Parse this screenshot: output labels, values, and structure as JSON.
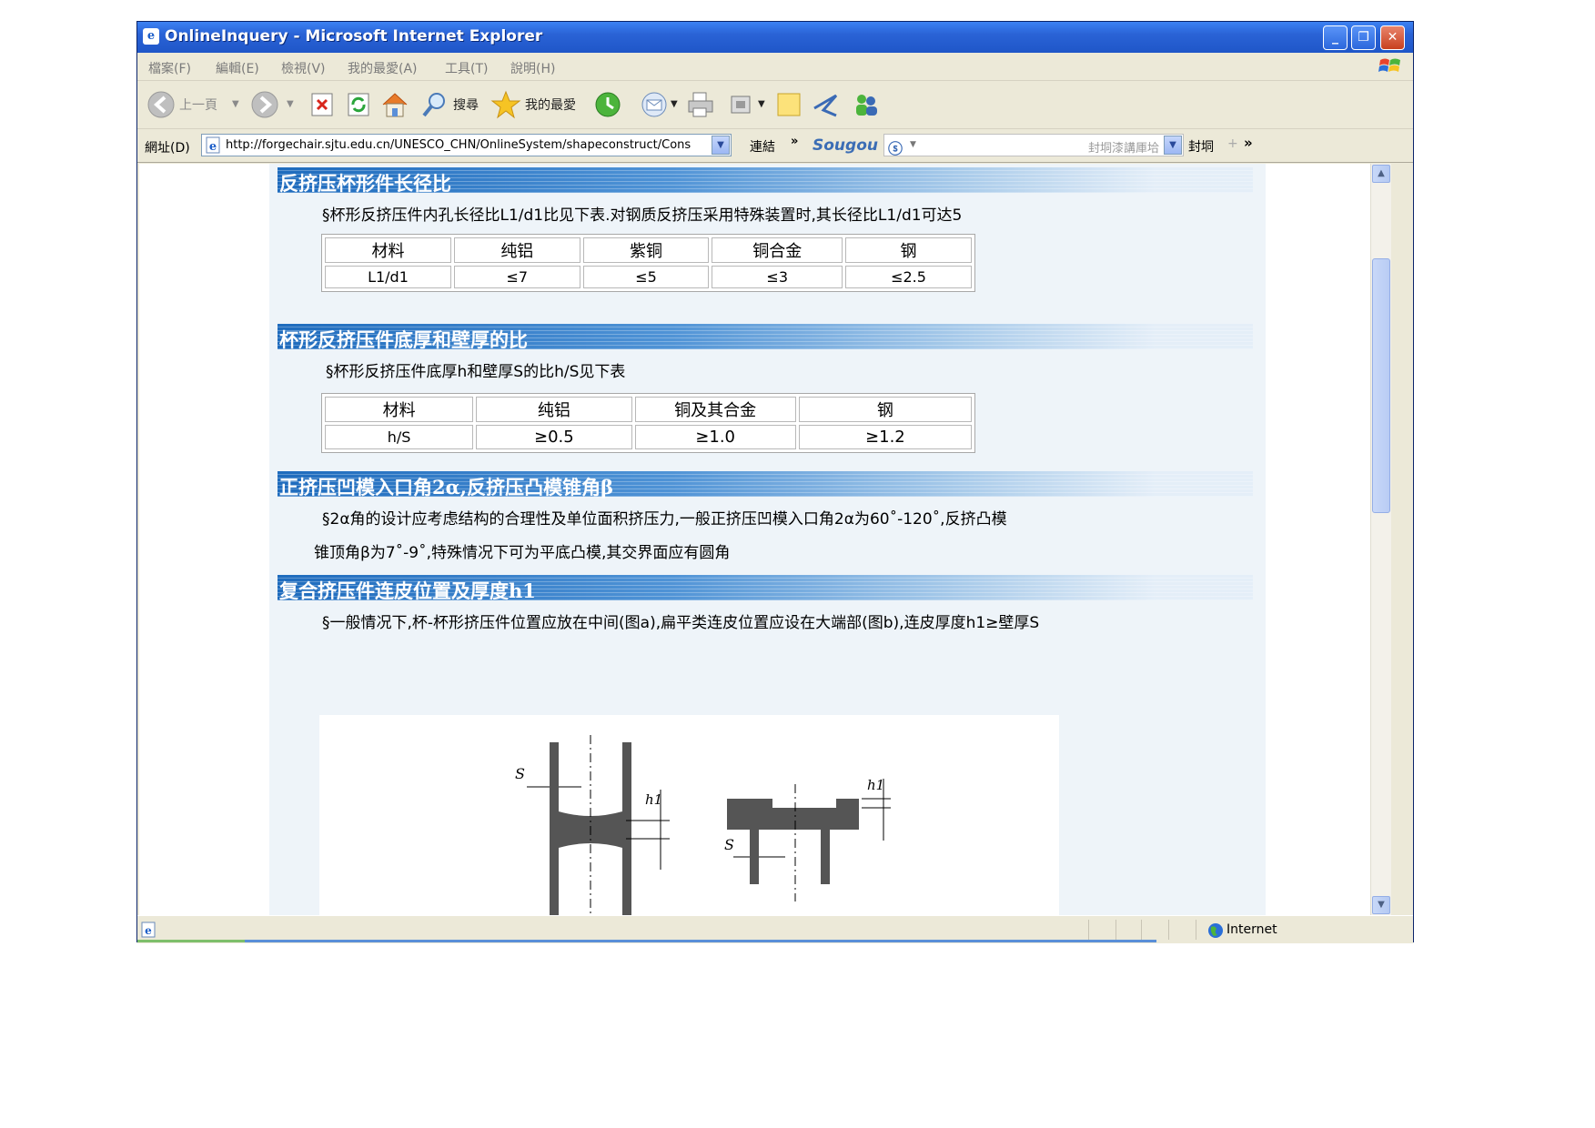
{
  "window": {
    "title": "OnlineInquery - Microsoft Internet Explorer",
    "icon": "ie-icon"
  },
  "menu": [
    "檔案(F)",
    "編輯(E)",
    "檢視(V)",
    "我的最愛(A)",
    "工具(T)",
    "說明(H)"
  ],
  "toolbar": {
    "back_label": "上一頁",
    "search_label": "搜尋",
    "favorites_label": "我的最愛"
  },
  "address": {
    "label": "網址(D)",
    "url": "http://forgechair.sjtu.edu.cn/UNESCO_CHN/OnlineSystem/shapeconstruct/Cons",
    "links_label": "連結",
    "sougou_label": "Sougou",
    "search_placeholder": "封垌漆講厙垥",
    "search_button": "封垌"
  },
  "sections": [
    {
      "title": "反挤压杯形件长径比",
      "text": "§杯形反挤压件内孔长径比L1/d1比见下表.对钢质反挤压采用特殊装置时,其长径比L1/d1可达5",
      "table": [
        [
          "材料",
          "纯铝",
          "紫铜",
          "铜合金",
          "钢"
        ],
        [
          "L1/d1",
          "≤7",
          "≤5",
          "≤3",
          "≤2.5"
        ]
      ]
    },
    {
      "title": "杯形反挤压件底厚和壁厚的比",
      "text": "§杯形反挤压件底厚h和壁厚S的比h/S见下表",
      "table": [
        [
          "材料",
          "纯铝",
          "铜及其合金",
          "钢"
        ],
        [
          "h/S",
          "≥0.5",
          "≥1.0",
          "≥1.2"
        ]
      ]
    },
    {
      "title": "正挤压凹模入口角2α,反挤压凸模锥角β",
      "text_line1": "§2α角的设计应考虑结构的合理性及单位面积挤压力,一般正挤压凹模入口角2α为60˚-120˚,反挤凸模",
      "text_line2": "锥顶角β为7˚-9˚,特殊情况下可为平底凸模,其交界面应有圆角"
    },
    {
      "title": "复合挤压件连皮位置及厚度h1",
      "text": "§一般情况下,杯-杯形挤压件位置应放在中间(图a),扁平类连皮位置应设在大端部(图b),连皮厚度h1≥壁厚S",
      "figure_labels": {
        "s": "S",
        "h1": "h1"
      }
    }
  ],
  "status": {
    "zone": "Internet"
  }
}
